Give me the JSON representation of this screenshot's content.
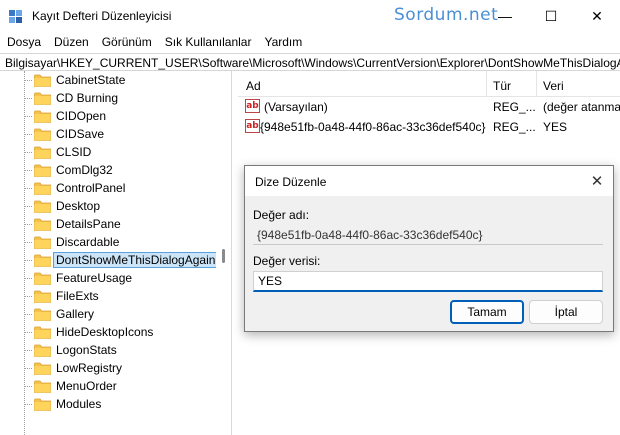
{
  "window": {
    "title": "Kayıt Defteri Düzenleyicisi",
    "watermark": "Sordum.net",
    "minimize": "—",
    "maximize": "☐",
    "close": "✕"
  },
  "menu": [
    "Dosya",
    "Düzen",
    "Görünüm",
    "Sık Kullanılanlar",
    "Yardım"
  ],
  "address": "Bilgisayar\\HKEY_CURRENT_USER\\Software\\Microsoft\\Windows\\CurrentVersion\\Explorer\\DontShowMeThisDialogAg",
  "tree": {
    "items": [
      "CabinetState",
      "CD Burning",
      "CIDOpen",
      "CIDSave",
      "CLSID",
      "ComDlg32",
      "ControlPanel",
      "Desktop",
      "DetailsPane",
      "Discardable",
      "DontShowMeThisDialogAgain",
      "FeatureUsage",
      "FileExts",
      "Gallery",
      "HideDesktopIcons",
      "LogonStats",
      "LowRegistry",
      "MenuOrder",
      "Modules"
    ],
    "selected": "DontShowMeThisDialogAgain"
  },
  "list": {
    "headers": {
      "name": "Ad",
      "type": "Tür",
      "data": "Veri"
    },
    "rows": [
      {
        "icon": "ab",
        "name": "(Varsayılan)",
        "type": "REG_...",
        "data": "(değer atanmamış)"
      },
      {
        "icon": "ab",
        "name": "{948e51fb-0a48-44f0-86ac-33c36def540c}",
        "type": "REG_...",
        "data": "YES"
      }
    ]
  },
  "dialog": {
    "title": "Dize Düzenle",
    "close": "✕",
    "value_name_label": "Değer adı:",
    "value_name": "{948e51fb-0a48-44f0-86ac-33c36def540c}",
    "value_data_label": "Değer verisi:",
    "value_data": "YES",
    "ok": "Tamam",
    "cancel": "İptal"
  },
  "colors": {
    "accent": "#005fb8",
    "folder": "#f4c24d",
    "selection": "#cce4f7"
  }
}
